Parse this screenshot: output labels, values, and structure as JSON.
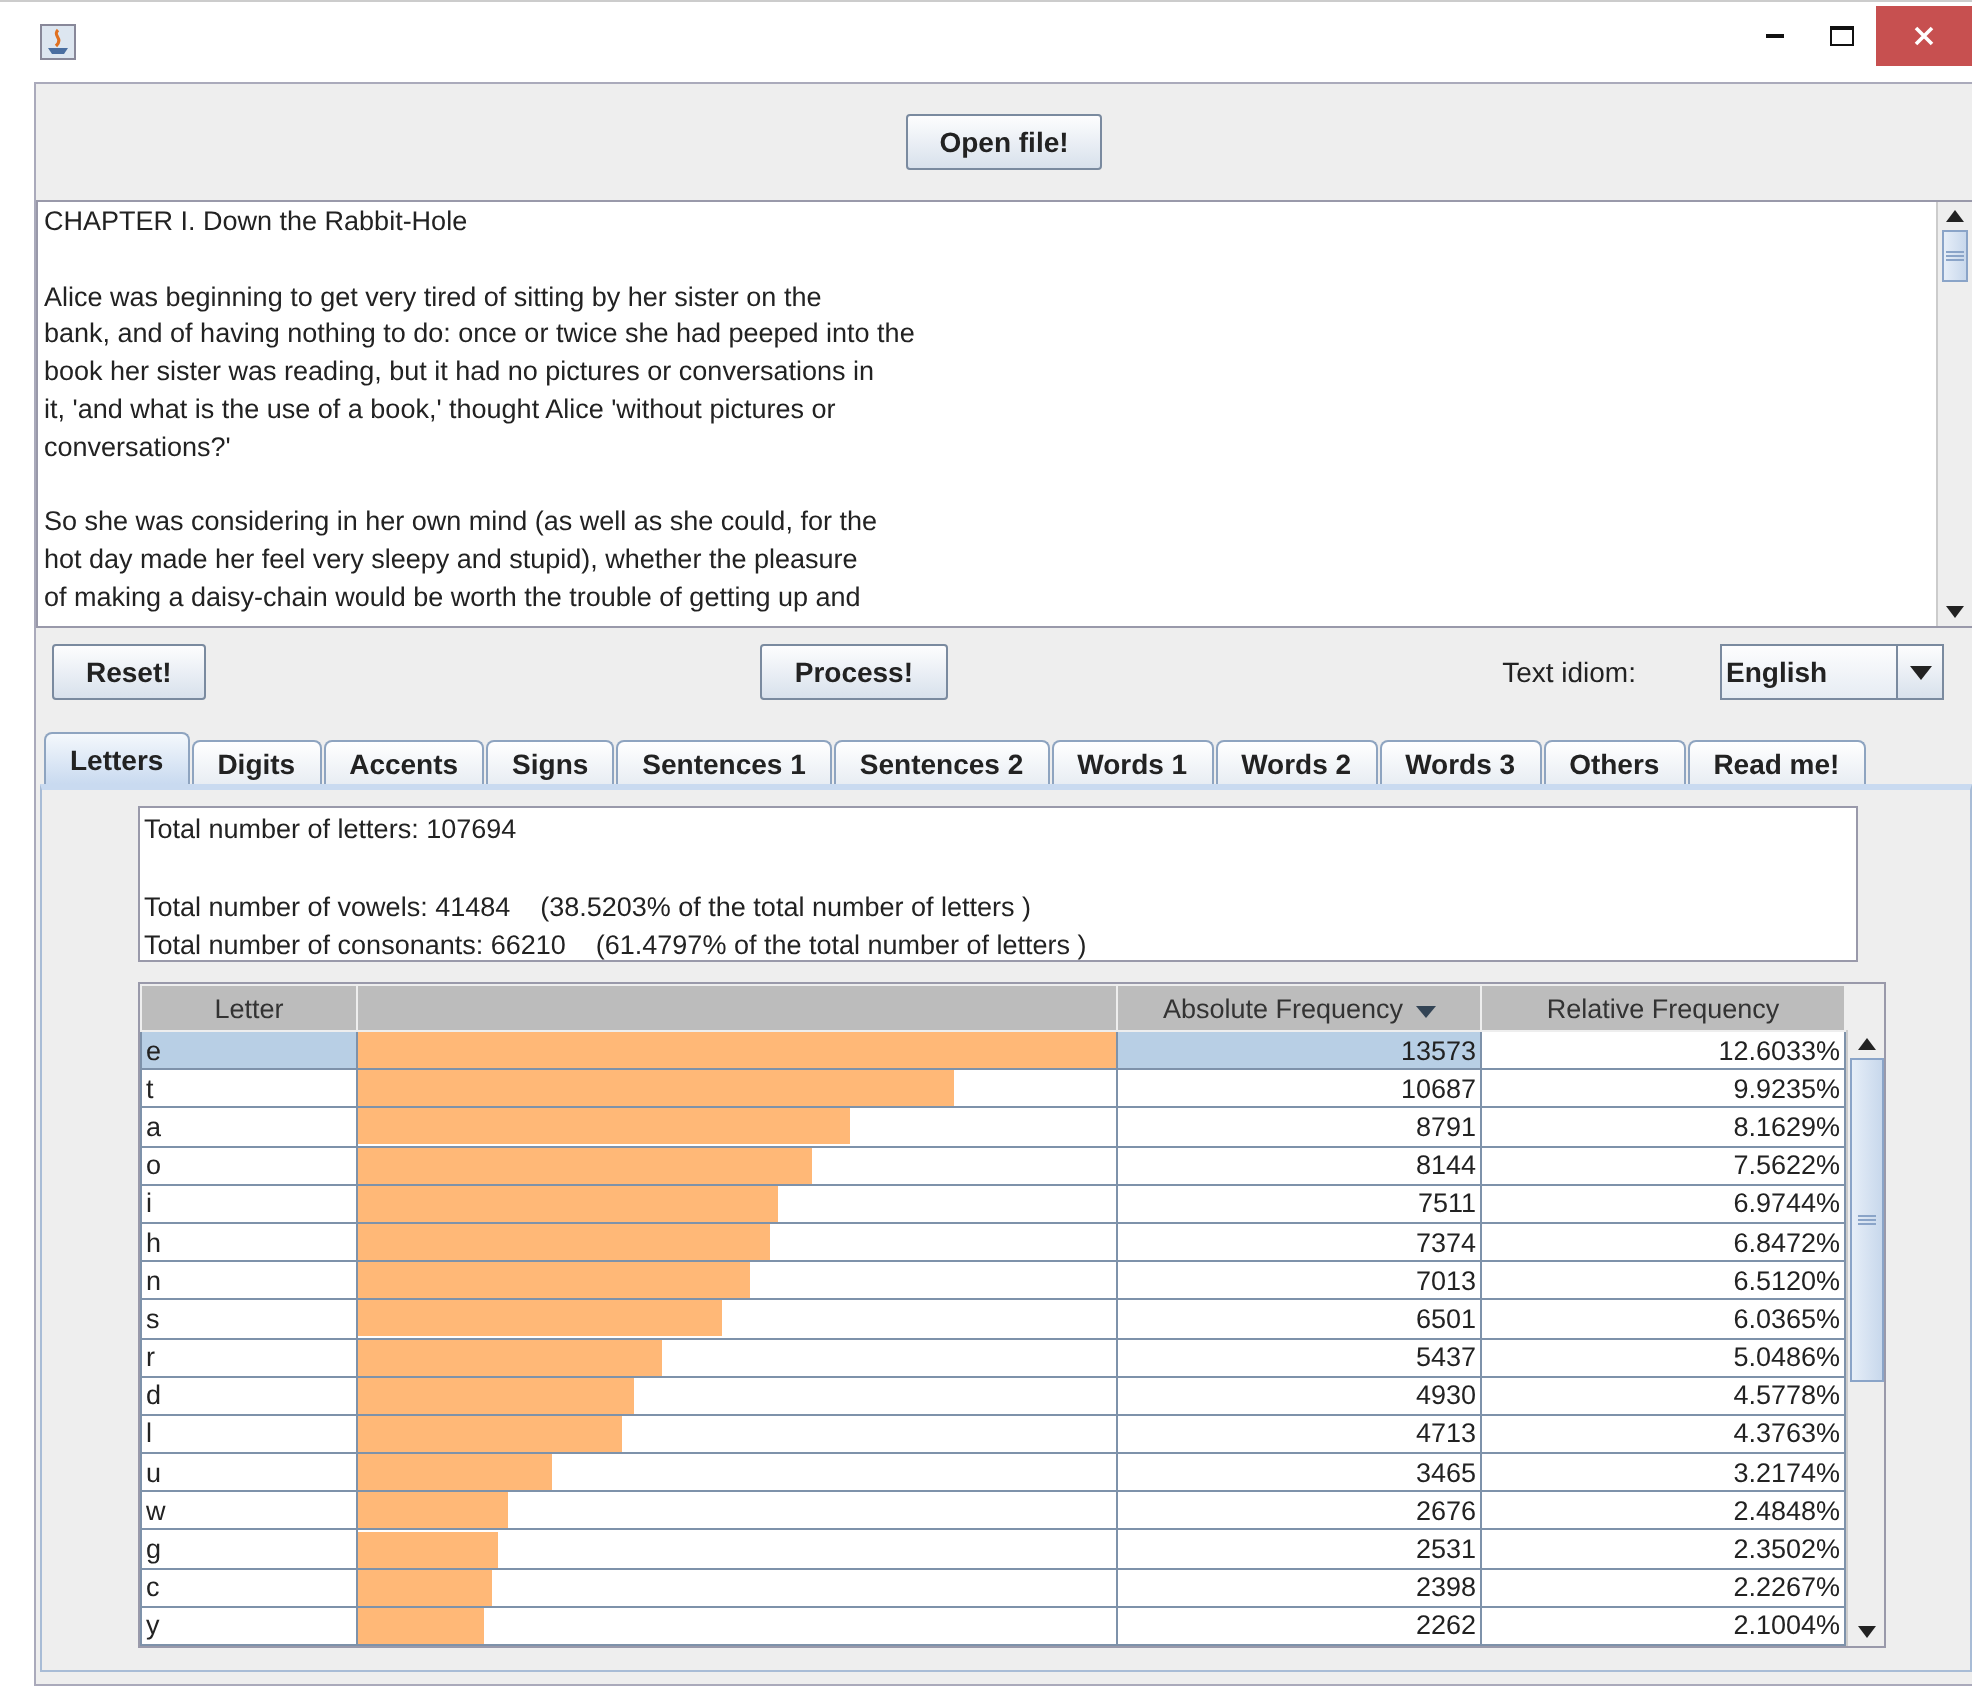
{
  "open_button": "Open file!",
  "text_area": {
    "paragraphs": [
      [
        "CHAPTER I. Down the Rabbit-Hole"
      ],
      [
        "Alice was beginning to get very tired of sitting by her sister on the",
        "bank, and of having nothing to do: once or twice she had peeped into the",
        "book her sister was reading, but it had no pictures or conversations in",
        "it, 'and what is the use of a book,' thought Alice 'without pictures or",
        "conversations?'"
      ],
      [
        "So she was considering in her own mind (as well as she could, for the",
        "hot day made her feel very sleepy and stupid), whether the pleasure",
        "of making a daisy-chain would be worth the trouble of getting up and"
      ]
    ]
  },
  "reset_button": "Reset!",
  "process_button": "Process!",
  "idiom": {
    "label": "Text idiom:",
    "value": "English"
  },
  "tabs": [
    {
      "label": "Letters",
      "selected": true
    },
    {
      "label": "Digits",
      "selected": false
    },
    {
      "label": "Accents",
      "selected": false
    },
    {
      "label": "Signs",
      "selected": false
    },
    {
      "label": "Sentences 1",
      "selected": false
    },
    {
      "label": "Sentences 2",
      "selected": false
    },
    {
      "label": "Words 1",
      "selected": false
    },
    {
      "label": "Words 2",
      "selected": false
    },
    {
      "label": "Words 3",
      "selected": false
    },
    {
      "label": "Others",
      "selected": false
    },
    {
      "label": "Read me!",
      "selected": false
    }
  ],
  "summary": {
    "paragraphs": [
      [
        "Total number of letters: 107694"
      ],
      [
        "Total number of vowels: 41484    (38.5203% of the total number of letters )",
        "Total number of consonants: 66210    (61.4797% of the total number of letters )"
      ]
    ]
  },
  "table": {
    "columns": [
      {
        "label": "Letter",
        "sorted": false
      },
      {
        "label": "Absolute Frequency",
        "sorted": true
      },
      {
        "label": "Relative Frequency",
        "sorted": false
      }
    ],
    "rows": [
      {
        "letter": "e",
        "level": 1.0,
        "absolute": "13573",
        "relative": "12.6033%",
        "selected": true
      },
      {
        "letter": "t",
        "level": 0.787,
        "absolute": "10687",
        "relative": "9.9235%",
        "selected": false
      },
      {
        "letter": "a",
        "level": 0.648,
        "absolute": "8791",
        "relative": "8.1629%",
        "selected": false
      },
      {
        "letter": "o",
        "level": 0.6,
        "absolute": "8144",
        "relative": "7.5622%",
        "selected": false
      },
      {
        "letter": "i",
        "level": 0.553,
        "absolute": "7511",
        "relative": "6.9744%",
        "selected": false
      },
      {
        "letter": "h",
        "level": 0.543,
        "absolute": "7374",
        "relative": "6.8472%",
        "selected": false
      },
      {
        "letter": "n",
        "level": 0.517,
        "absolute": "7013",
        "relative": "6.5120%",
        "selected": false
      },
      {
        "letter": "s",
        "level": 0.479,
        "absolute": "6501",
        "relative": "6.0365%",
        "selected": false
      },
      {
        "letter": "r",
        "level": 0.401,
        "absolute": "5437",
        "relative": "5.0486%",
        "selected": false
      },
      {
        "letter": "d",
        "level": 0.363,
        "absolute": "4930",
        "relative": "4.5778%",
        "selected": false
      },
      {
        "letter": "l",
        "level": 0.347,
        "absolute": "4713",
        "relative": "4.3763%",
        "selected": false
      },
      {
        "letter": "u",
        "level": 0.255,
        "absolute": "3465",
        "relative": "3.2174%",
        "selected": false
      },
      {
        "letter": "w",
        "level": 0.197,
        "absolute": "2676",
        "relative": "2.4848%",
        "selected": false
      },
      {
        "letter": "g",
        "level": 0.186,
        "absolute": "2531",
        "relative": "2.3502%",
        "selected": false
      },
      {
        "letter": "c",
        "level": 0.177,
        "absolute": "2398",
        "relative": "2.2267%",
        "selected": false
      },
      {
        "letter": "y",
        "level": 0.167,
        "absolute": "2262",
        "relative": "2.1004%",
        "selected": false
      }
    ]
  }
}
